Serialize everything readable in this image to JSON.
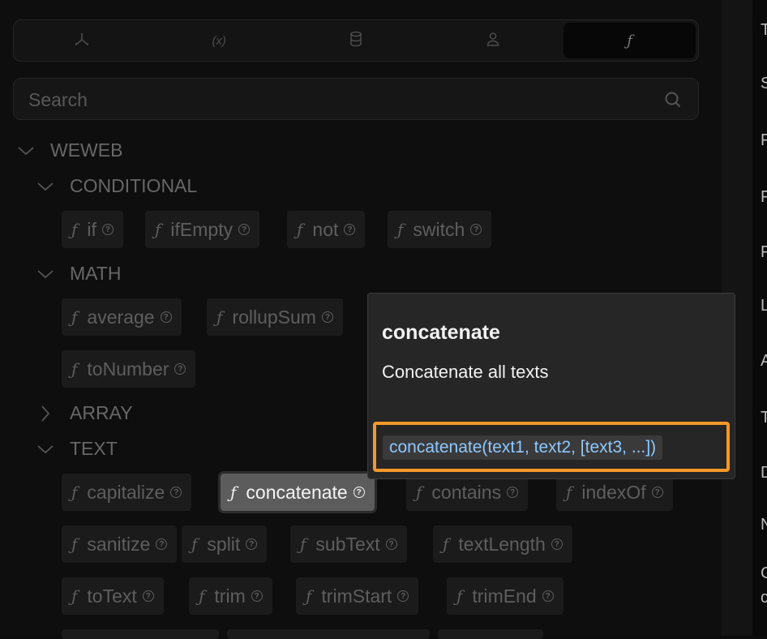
{
  "tabs": [
    {
      "icon": "workflow-icon",
      "label": "⅄",
      "active": false
    },
    {
      "icon": "variable-icon",
      "label": "(x)",
      "active": false
    },
    {
      "icon": "database-icon",
      "label": "▤",
      "active": false
    },
    {
      "icon": "user-icon",
      "label": "◯",
      "active": false
    },
    {
      "icon": "formula-icon",
      "label": "ƒ",
      "active": true
    }
  ],
  "search": {
    "placeholder": "Search"
  },
  "tree": {
    "root": "WEWEB",
    "conditional": {
      "label": "CONDITIONAL",
      "items": [
        "if",
        "ifEmpty",
        "not",
        "switch"
      ]
    },
    "math": {
      "label": "MATH",
      "items": [
        "average",
        "rollupSum",
        "toNumber"
      ]
    },
    "array": {
      "label": "ARRAY"
    },
    "text": {
      "label": "TEXT",
      "items": [
        "capitalize",
        "concatenate",
        "contains",
        "indexOf",
        "sanitize",
        "split",
        "subText",
        "textLength",
        "toText",
        "trim",
        "trimStart",
        "trimEnd"
      ]
    }
  },
  "glyphs": {
    "fn": "ƒ",
    "help": "?"
  },
  "tooltip": {
    "title": "concatenate",
    "description": "Concatenate all texts",
    "signature": "concatenate(text1, text2, [text3, ...])"
  },
  "right_edge_letters": [
    "T",
    "S",
    "F",
    "F",
    "F",
    "L",
    "A",
    "T",
    "D",
    "N",
    "C",
    "c"
  ],
  "colors": {
    "accent": "#f5972a",
    "signature_text": "#8ec8ff"
  }
}
